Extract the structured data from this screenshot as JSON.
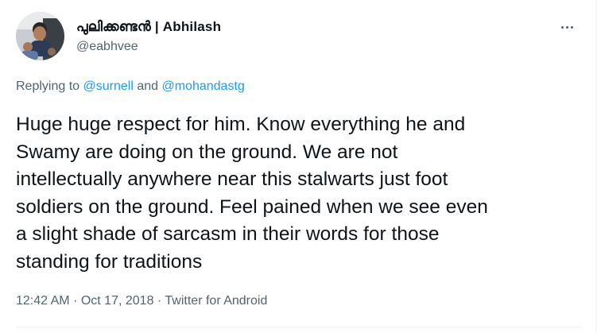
{
  "author": {
    "display_name": "പുലിക്കണ്ടൻ | Abhilash",
    "handle": "@eabhvee"
  },
  "icons": {
    "avatar": "profile-photo",
    "more": "more-dots-icon"
  },
  "replying": {
    "prefix": "Replying to",
    "mention_1": "@surnell",
    "conjunction": "and",
    "mention_2": "@mohandastg"
  },
  "tweet": {
    "text": "Huge huge respect for him. Know everything he and\nSwamy are doing on the ground. We are not\nintellectually anywhere near this stalwarts just foot\nsoldiers on the ground. Feel pained when we see even\na slight shade of sarcasm in their words for those\nstanding for traditions"
  },
  "meta": {
    "time": "12:42 AM",
    "separator": "·",
    "date": "Oct 17, 2018",
    "source": "Twitter for Android"
  },
  "colors": {
    "text_primary": "#0f1419",
    "text_secondary": "#536471",
    "link": "#1d9bf0",
    "divider": "#eff3f4"
  }
}
